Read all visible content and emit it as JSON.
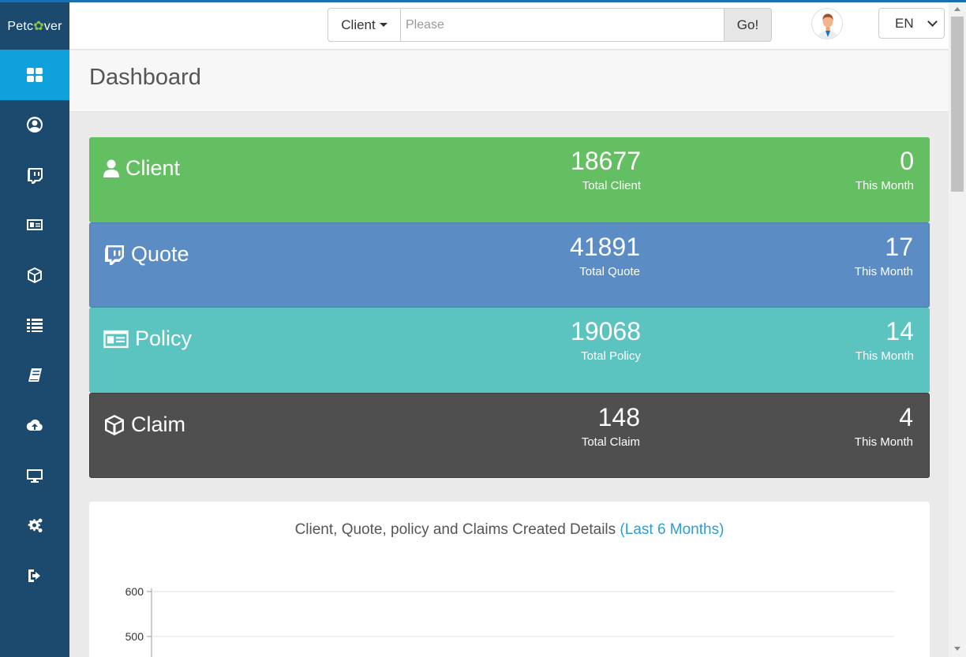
{
  "app": {
    "logo_left": "Petc",
    "logo_paw": "✿",
    "logo_right": "ver"
  },
  "header": {
    "search_type": "Client",
    "search_placeholder": "Please",
    "go_label": "Go!",
    "language": "EN"
  },
  "sidebar": {
    "items": [
      {
        "icon": "dashboard-icon",
        "active": true
      },
      {
        "icon": "user-circle-icon"
      },
      {
        "icon": "twitch-icon"
      },
      {
        "icon": "id-card-icon"
      },
      {
        "icon": "cube-icon"
      },
      {
        "icon": "list-icon"
      },
      {
        "icon": "book-icon"
      },
      {
        "icon": "cloud-upload-icon"
      },
      {
        "icon": "monitor-icon"
      },
      {
        "icon": "cogs-icon"
      },
      {
        "icon": "sign-out-icon"
      }
    ]
  },
  "page": {
    "title": "Dashboard"
  },
  "cards": {
    "client": {
      "title": "Client",
      "total": "18677",
      "total_label": "Total Client",
      "month": "0",
      "month_label": "This Month",
      "color": "#64bf62"
    },
    "quote": {
      "title": "Quote",
      "total": "41891",
      "total_label": "Total Quote",
      "month": "17",
      "month_label": "This Month",
      "color": "#5b8dc4"
    },
    "policy": {
      "title": "Policy",
      "total": "19068",
      "total_label": "Total Policy",
      "month": "14",
      "month_label": "This Month",
      "color": "#5bc4c0"
    },
    "claim": {
      "title": "Claim",
      "total": "148",
      "total_label": "Total Claim",
      "month": "4",
      "month_label": "This Month",
      "color": "#4f4f4f"
    }
  },
  "chart_panel": {
    "title": "Client, Quote, policy and Claims Created Details",
    "title_highlight": "(Last 6 Months)"
  },
  "chart_data": {
    "type": "line",
    "title": "Client, Quote, policy and Claims Created Details (Last 6 Months)",
    "xlabel": "",
    "ylabel": "",
    "y_ticks_visible": [
      600,
      500
    ],
    "grid": true
  }
}
